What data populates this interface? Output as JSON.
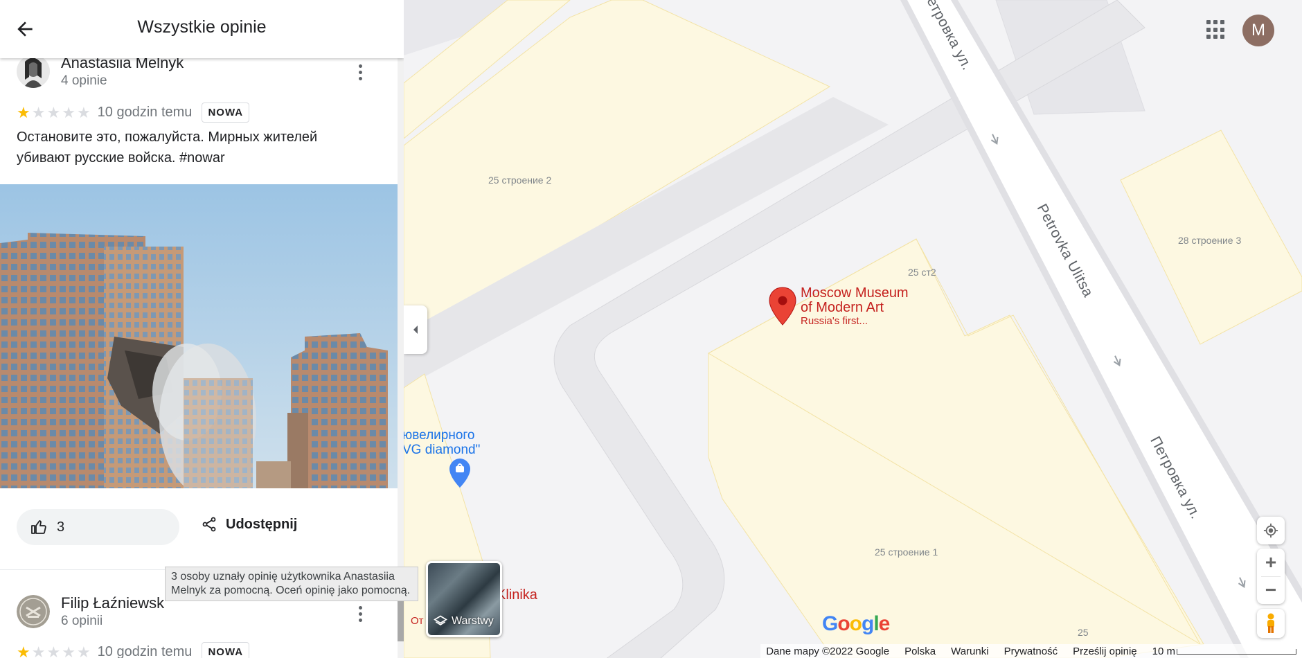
{
  "panel": {
    "title": "Wszystkie opinie"
  },
  "reviews": [
    {
      "name": "Anastasiia Melnyk",
      "count": "4 opinie",
      "rating": 1,
      "time": "10 godzin temu",
      "badge": "NOWA",
      "text": "Остановите это, пожалуйста.  Мирных жителей убивают русские войска. #nowar",
      "likes": "3",
      "share_label": "Udostępnij"
    },
    {
      "name": "Filip Łaźniewsk",
      "count": "6 opinii",
      "rating": 1,
      "time": "10 godzin temu",
      "badge": "NOWA"
    }
  ],
  "tooltip": " 3 osoby uznały opinię użytkownika Anastasiia Melnyk za pomocną. Oceń opinię jako pomocną.",
  "map": {
    "labels": {
      "b1": "25 строение 2",
      "b2": "28 строение 3",
      "b3": "25 ст2",
      "b4": "25 строение 1",
      "b5": "25"
    },
    "streets": {
      "s1": "Петровка ул.",
      "s2": "Petrovka Ulitsa",
      "s3": "Петровка ул."
    },
    "poi": {
      "title_line1": "Moscow Museum",
      "title_line2": "of Modern Art",
      "subtitle": "Russia's first..."
    },
    "jewel_line1": "ювелирного",
    "jewel_line2": "VG diamond\"",
    "klinika": "Klinika",
    "ot": "От",
    "layers_label": "Warstwy",
    "account_initial": "M",
    "logo": "Google",
    "footer": {
      "data": "Dane mapy ©2022 Google",
      "country": "Polska",
      "terms": "Warunki",
      "privacy": "Prywatność",
      "feedback": "Prześlij opinię",
      "scale": "10 m"
    },
    "colors": {
      "building_fill": "#fdf8e1",
      "building_stroke": "#f3e3a6",
      "road": "#ffffff",
      "road_gray": "#e6e6e9",
      "pin": "#ea4335"
    }
  }
}
